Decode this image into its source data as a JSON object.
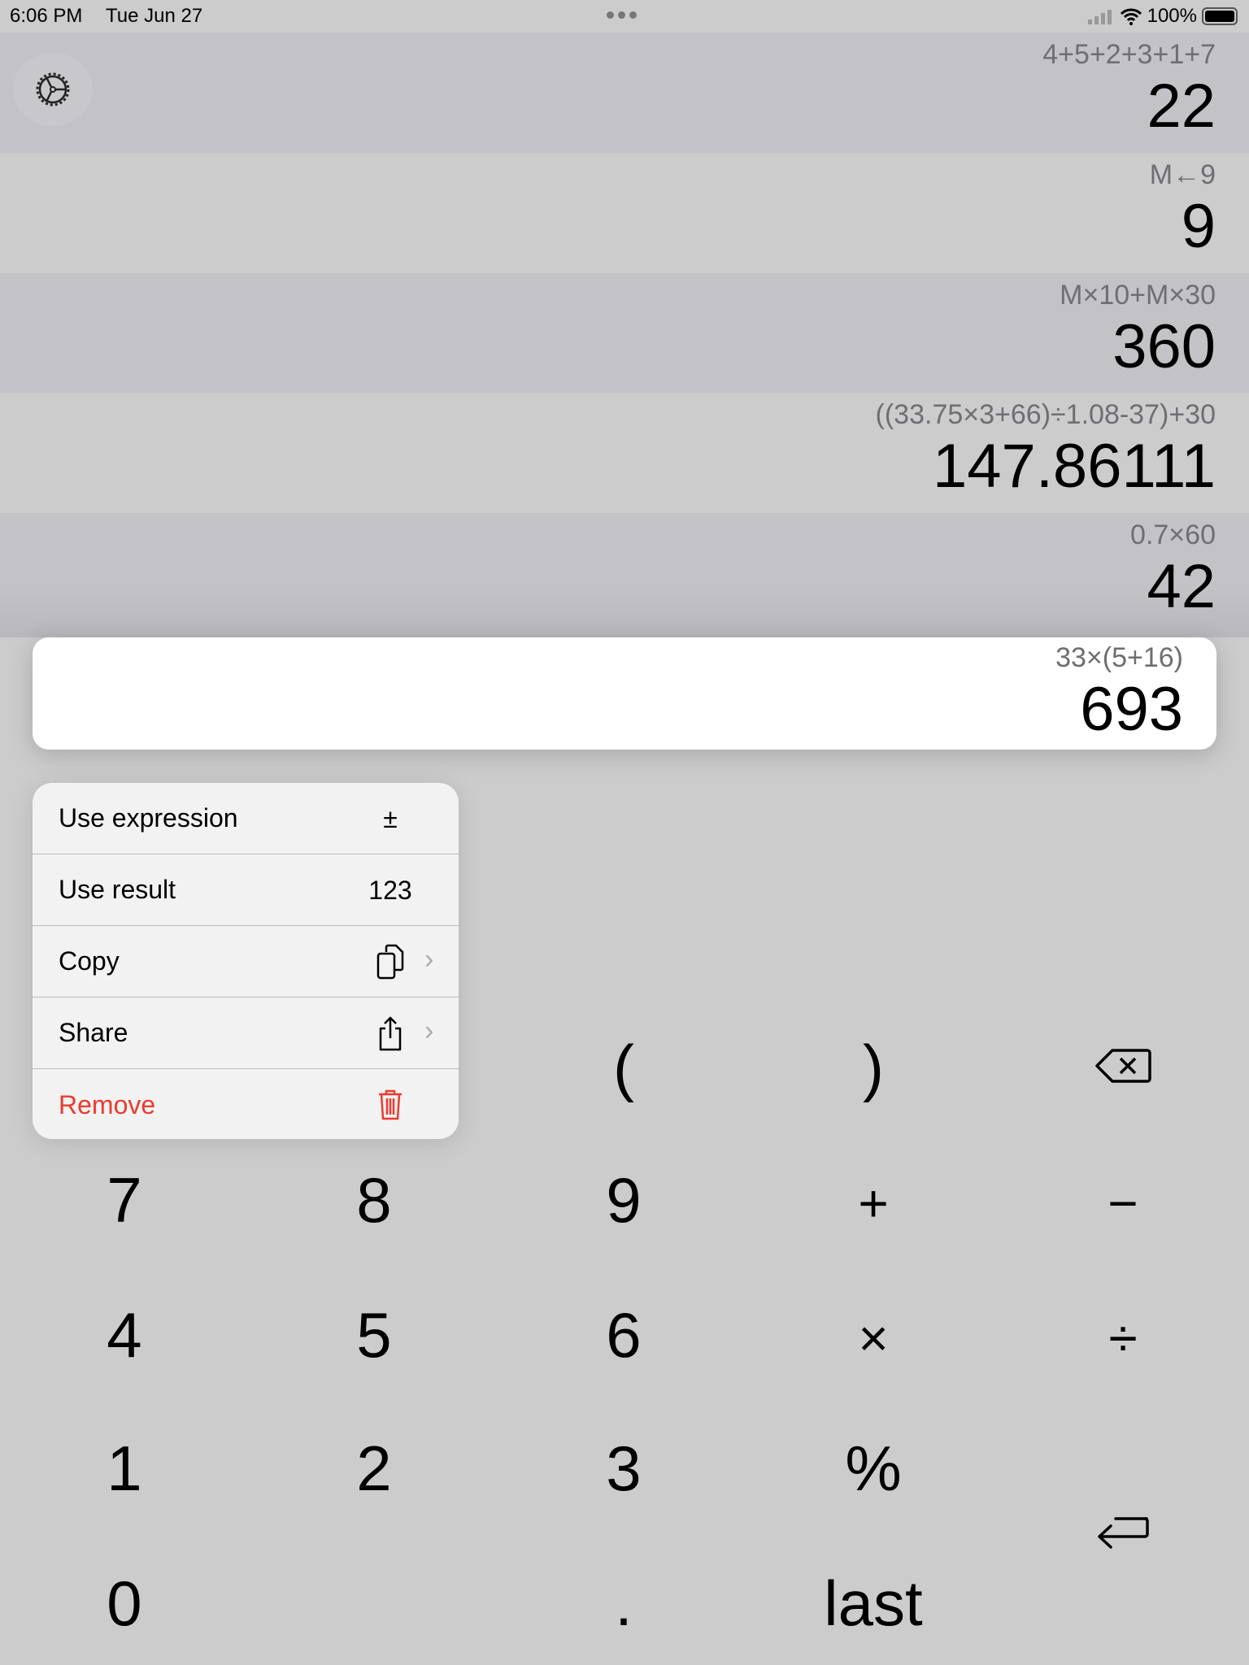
{
  "status": {
    "time": "6:06 PM",
    "date": "Tue Jun 27",
    "battery": "100%"
  },
  "history": [
    {
      "expression": "4+5+2+3+1+7",
      "result": "22"
    },
    {
      "expression": "M←9",
      "result": "9"
    },
    {
      "expression": "M×10+M×30",
      "result": "360"
    },
    {
      "expression": "((33.75×3+66)÷1.08-37)+30",
      "result": "147.86111"
    },
    {
      "expression": "0.7×60",
      "result": "42"
    }
  ],
  "selected": {
    "expression": "33×(5+16)",
    "result": "693"
  },
  "menu": {
    "use_expression": "Use expression",
    "use_expression_icon": "±",
    "use_result": "Use result",
    "use_result_icon": "123",
    "copy": "Copy",
    "share": "Share",
    "remove": "Remove"
  },
  "keys": {
    "open_paren": "(",
    "close_paren": ")",
    "k7": "7",
    "k8": "8",
    "k9": "9",
    "plus": "+",
    "minus": "−",
    "k4": "4",
    "k5": "5",
    "k6": "6",
    "times": "×",
    "divide": "÷",
    "k1": "1",
    "k2": "2",
    "k3": "3",
    "percent": "%",
    "k0": "0",
    "dot": ".",
    "last": "last"
  },
  "colors": {
    "remove": "#eb3b30",
    "row_dark": "#c3c2c7",
    "row_light": "#cccccc"
  }
}
